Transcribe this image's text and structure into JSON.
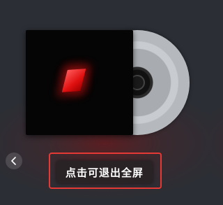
{
  "player": {
    "exit_fullscreen_label": "点击可退出全屏"
  },
  "icons": {
    "back": "chevron-left-icon",
    "cover": "album-cover",
    "disc": "vinyl-disc"
  },
  "colors": {
    "highlight_border": "#e53935",
    "cover_accent": "#e01010",
    "button_bg": "#2a2326",
    "button_text": "#ffffff"
  }
}
